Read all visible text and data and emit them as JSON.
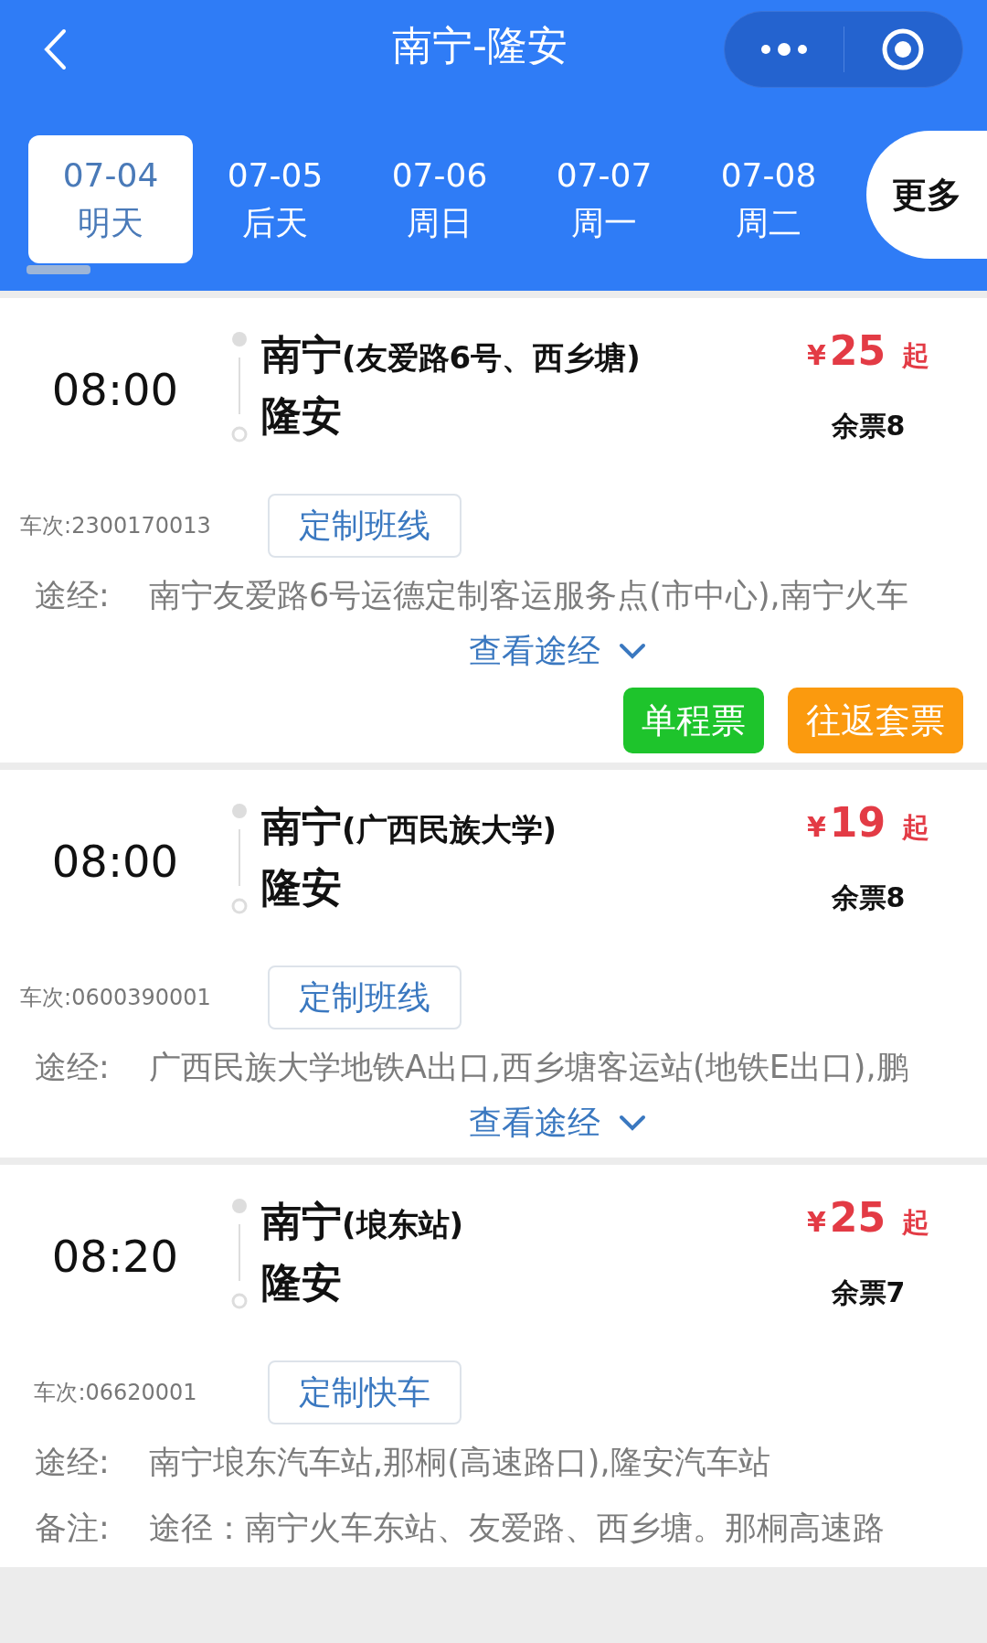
{
  "header": {
    "title": "南宁-隆安"
  },
  "dates": [
    {
      "date": "07-04",
      "day": "明天",
      "selected": true
    },
    {
      "date": "07-05",
      "day": "后天",
      "selected": false
    },
    {
      "date": "07-06",
      "day": "周日",
      "selected": false
    },
    {
      "date": "07-07",
      "day": "周一",
      "selected": false
    },
    {
      "date": "07-08",
      "day": "周二",
      "selected": false
    }
  ],
  "more": "更多",
  "trips": [
    {
      "time": "08:00",
      "from": "南宁",
      "from_detail": "(友爱路6号、西乡塘)",
      "to": "隆安",
      "currency": "¥",
      "price": "25",
      "price_suffix": "起",
      "seats": "余票8",
      "trip_no": "车次:2300170013",
      "tag": "定制班线",
      "details": [
        {
          "label": "途经:",
          "text": "南宁友爱路6号运德定制客运服务点(市中心),南宁火车"
        }
      ],
      "toggle": "查看途经",
      "buttons": [
        {
          "label": "单程票",
          "color": "#1ec42c"
        },
        {
          "label": "往返套票",
          "color": "#fb9a0e"
        }
      ]
    },
    {
      "time": "08:00",
      "from": "南宁",
      "from_detail": "(广西民族大学)",
      "to": "隆安",
      "currency": "¥",
      "price": "19",
      "price_suffix": "起",
      "seats": "余票8",
      "trip_no": "车次:0600390001",
      "tag": "定制班线",
      "details": [
        {
          "label": "途经:",
          "text": "广西民族大学地铁A出口,西乡塘客运站(地铁E出口),鹏"
        }
      ],
      "toggle": "查看途经"
    },
    {
      "time": "08:20",
      "from": "南宁",
      "from_detail": "(埌东站)",
      "to": "隆安",
      "currency": "¥",
      "price": "25",
      "price_suffix": "起",
      "seats": "余票7",
      "trip_no": "车次:06620001",
      "tag": "定制快车",
      "details": [
        {
          "label": "途经:",
          "text": "南宁埌东汽车站,那桐(高速路口),隆安汽车站"
        },
        {
          "label": "备注:",
          "text": "途径：南宁火车东站、友爱路、西乡塘。那桐高速路"
        }
      ]
    }
  ]
}
